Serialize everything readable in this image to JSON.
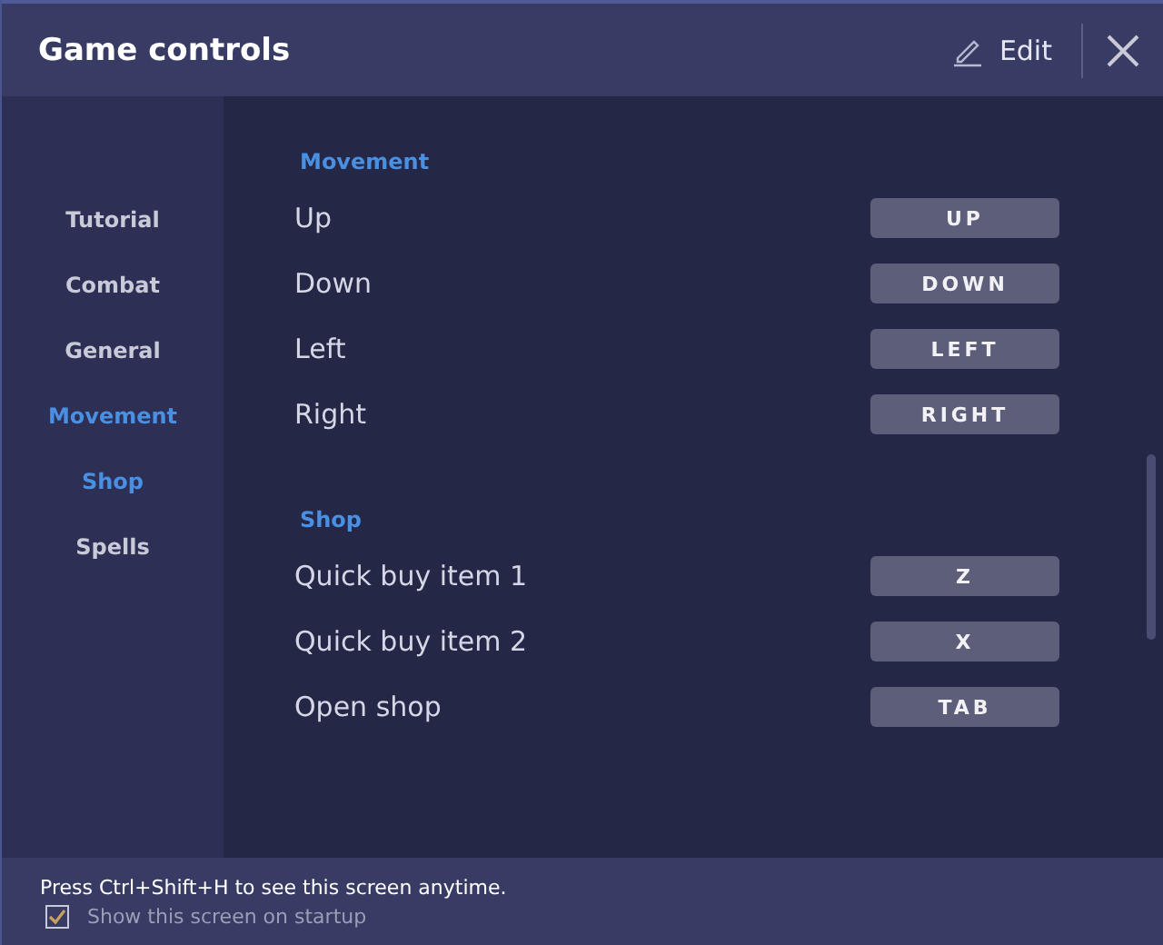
{
  "window": {
    "title": "Game controls",
    "edit_label": "Edit"
  },
  "sidebar": {
    "items": [
      {
        "label": "Tutorial",
        "selected": false
      },
      {
        "label": "Combat",
        "selected": false
      },
      {
        "label": "General",
        "selected": false
      },
      {
        "label": "Movement",
        "selected": true
      },
      {
        "label": "Shop",
        "selected": true
      },
      {
        "label": "Spells",
        "selected": false
      }
    ]
  },
  "sections": [
    {
      "title": "Movement",
      "controls": [
        {
          "action": "Up",
          "key": "UP"
        },
        {
          "action": "Down",
          "key": "DOWN"
        },
        {
          "action": "Left",
          "key": "LEFT"
        },
        {
          "action": "Right",
          "key": "RIGHT"
        }
      ]
    },
    {
      "title": "Shop",
      "controls": [
        {
          "action": "Quick buy item 1",
          "key": "Z"
        },
        {
          "action": "Quick buy item 2",
          "key": "X"
        },
        {
          "action": "Open shop",
          "key": "TAB"
        }
      ]
    }
  ],
  "footer": {
    "hint": "Press Ctrl+Shift+H to see this screen anytime.",
    "startup_checkbox": {
      "label": "Show this screen on startup",
      "checked": true
    }
  }
}
